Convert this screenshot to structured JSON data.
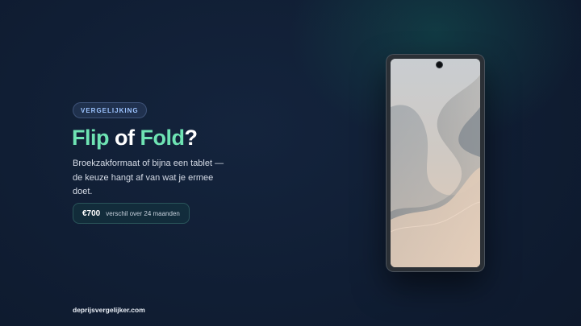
{
  "badge": {
    "label": "VERGELIJKING"
  },
  "headline": {
    "part1": "Flip",
    "part2": " of ",
    "part3": "Fold",
    "part4": "?"
  },
  "subtitle": "Broekzakformaat of bijna een tablet — de keuze hangt af van wat je ermee doet.",
  "stat": {
    "value": "€700",
    "label": "verschil over 24 maanden"
  },
  "footer": {
    "site": "deprijsvergelijker.com"
  },
  "colors": {
    "accent": "#6ee3b3",
    "badge_text": "#9cc3ff",
    "background": "#0f1c31"
  },
  "phone": {
    "icon": "smartphone-icon"
  }
}
